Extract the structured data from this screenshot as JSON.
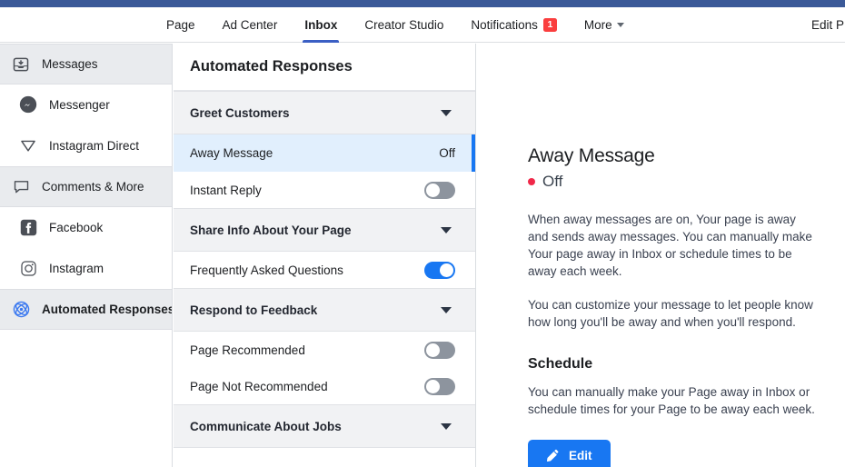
{
  "topnav": {
    "items": [
      {
        "label": "Page",
        "active": false,
        "badge": null,
        "caret": false
      },
      {
        "label": "Ad Center",
        "active": false,
        "badge": null,
        "caret": false
      },
      {
        "label": "Inbox",
        "active": true,
        "badge": null,
        "caret": false
      },
      {
        "label": "Creator Studio",
        "active": false,
        "badge": null,
        "caret": false
      },
      {
        "label": "Notifications",
        "active": false,
        "badge": "1",
        "caret": false
      },
      {
        "label": "More",
        "active": false,
        "badge": null,
        "caret": true
      }
    ],
    "right_label": "Edit P"
  },
  "sidebar": {
    "items": [
      {
        "label": "Messages",
        "icon": "inbox-tray-icon",
        "type": "group",
        "selected": false
      },
      {
        "label": "Messenger",
        "icon": "messenger-icon",
        "type": "child",
        "selected": false
      },
      {
        "label": "Instagram Direct",
        "icon": "paper-plane-icon",
        "type": "child",
        "selected": false
      },
      {
        "label": "Comments & More",
        "icon": "comment-bubble-icon",
        "type": "group",
        "selected": false
      },
      {
        "label": "Facebook",
        "icon": "facebook-icon",
        "type": "child",
        "selected": false
      },
      {
        "label": "Instagram",
        "icon": "instagram-icon",
        "type": "child",
        "selected": false
      },
      {
        "label": "Automated Responses",
        "icon": "automation-atom-icon",
        "type": "group",
        "selected": true
      }
    ]
  },
  "midpanel": {
    "header": "Automated Responses",
    "rows": [
      {
        "kind": "section",
        "label": "Greet Customers"
      },
      {
        "kind": "item",
        "label": "Away Message",
        "control": "status",
        "status": "Off",
        "selected": true
      },
      {
        "kind": "item",
        "label": "Instant Reply",
        "control": "toggle",
        "on": false,
        "selected": false
      },
      {
        "kind": "section",
        "label": "Share Info About Your Page"
      },
      {
        "kind": "item",
        "label": "Frequently Asked Questions",
        "control": "toggle",
        "on": true,
        "selected": false
      },
      {
        "kind": "section",
        "label": "Respond to Feedback"
      },
      {
        "kind": "item",
        "label": "Page Recommended",
        "control": "toggle",
        "on": false,
        "selected": false
      },
      {
        "kind": "item",
        "label": "Page Not Recommended",
        "control": "toggle",
        "on": false,
        "selected": false
      },
      {
        "kind": "section",
        "label": "Communicate About Jobs"
      }
    ]
  },
  "detail": {
    "title": "Away Message",
    "status": "Off",
    "status_color": "#f02849",
    "paragraph1": "When away messages are on, Your page is away and sends away messages. You can manually make Your page away in Inbox or schedule times to be away each week.",
    "paragraph2": "You can customize your message to let people know how long you'll be away and when you'll respond.",
    "schedule_heading": "Schedule",
    "paragraph3": "You can manually make your Page away in Inbox or schedule times for your Page to be away each week.",
    "edit_label": "Edit"
  },
  "colors": {
    "brand_blue": "#1877f2",
    "header_blue": "#3b5998",
    "badge_red": "#fa3e3e",
    "selected_row": "#e1effd"
  }
}
